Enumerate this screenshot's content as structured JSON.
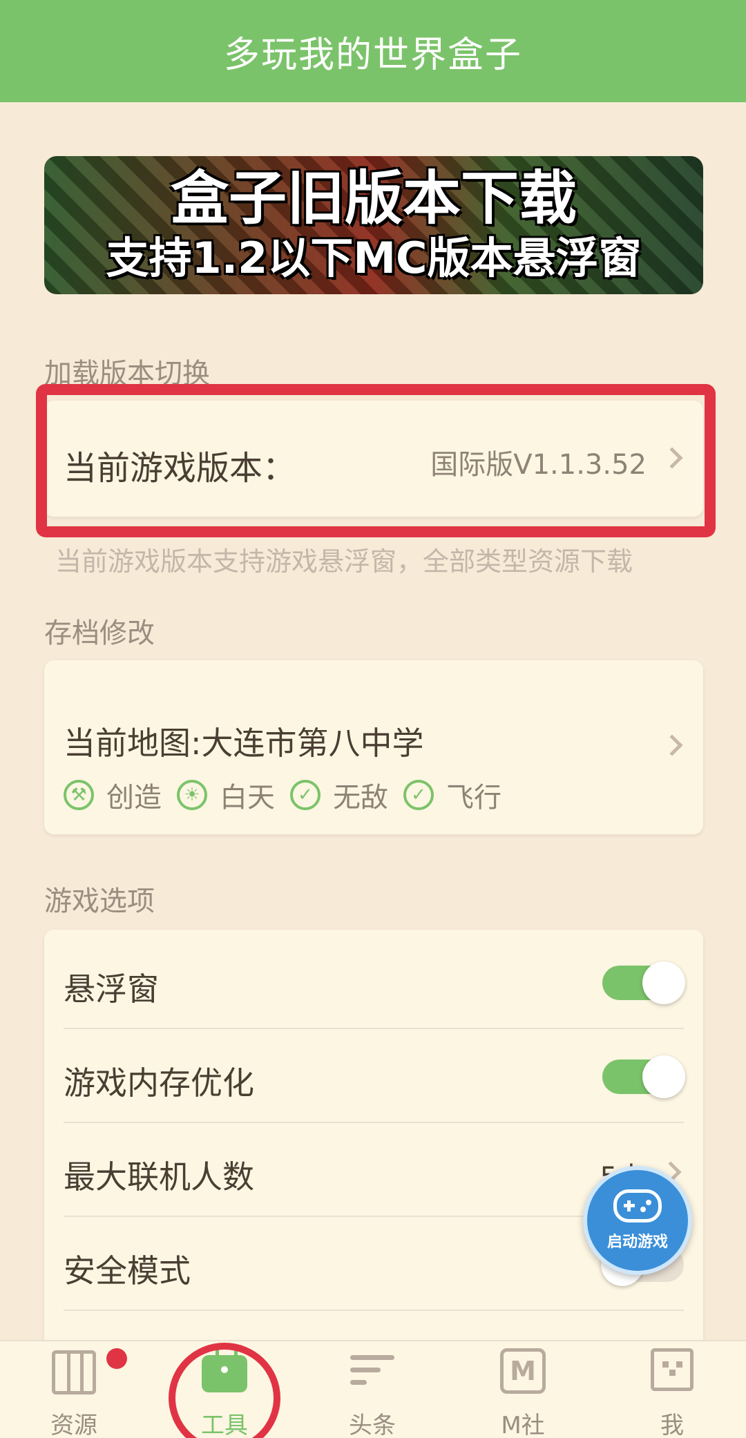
{
  "header": {
    "title": "多玩我的世界盒子"
  },
  "banner": {
    "line1": "盒子旧版本下载",
    "line2": "支持1.2以下MC版本悬浮窗"
  },
  "version_section": {
    "title": "加载版本切换",
    "label": "当前游戏版本：",
    "value": "国际版V1.1.3.52",
    "note": "当前游戏版本支持游戏悬浮窗，全部类型资源下载"
  },
  "save_section": {
    "title": "存档修改",
    "map_label": "当前地图:大连市第八中学",
    "tags": [
      "创造",
      "白天",
      "无敌",
      "飞行"
    ]
  },
  "options_section": {
    "title": "游戏选项",
    "rows": [
      {
        "label": "悬浮窗",
        "toggle": "on"
      },
      {
        "label": "游戏内存优化",
        "toggle": "on"
      },
      {
        "label": "最大联机人数",
        "value": "5人"
      },
      {
        "label": "安全模式",
        "toggle": "off"
      }
    ]
  },
  "fab": {
    "label": "启动游戏"
  },
  "tabs": [
    {
      "label": "资源",
      "icon": "map-icon",
      "badge": true
    },
    {
      "label": "工具",
      "icon": "toolbox-icon",
      "active": true
    },
    {
      "label": "头条",
      "icon": "news-icon"
    },
    {
      "label": "M社",
      "icon": "m-community-icon"
    },
    {
      "label": "我",
      "icon": "profile-icon"
    }
  ],
  "colors": {
    "accent": "#7bc36a",
    "highlight": "#e03444",
    "fab": "#3a8fd8"
  }
}
